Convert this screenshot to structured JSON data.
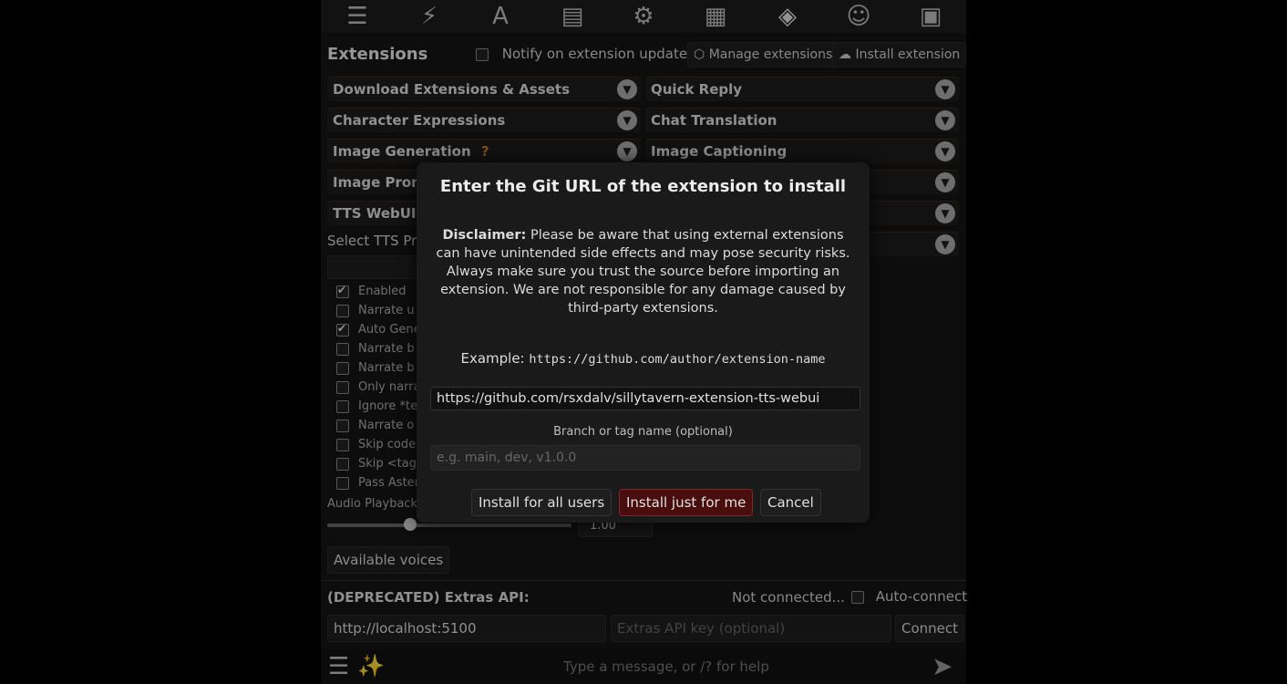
{
  "topbar": {
    "icons": [
      "sliders-icon",
      "plug-icon",
      "font-icon",
      "book-icon",
      "user-gear-icon",
      "image-icon",
      "cubes-icon",
      "smiley-icon",
      "id-card-icon"
    ]
  },
  "extensions": {
    "title": "Extensions",
    "notify_label": "Notify on extension updates",
    "manage_label": "Manage extensions",
    "install_label": "Install extension",
    "drawers_left": [
      "Download Extensions & Assets",
      "Character Expressions",
      "Image Generation",
      "Image Prom",
      "TTS WebUI A"
    ],
    "drawers_right": [
      "Quick Reply",
      "Chat Translation",
      "Image Captioning"
    ],
    "image_generation_help": "?"
  },
  "tts": {
    "select_label": "Select TTS Pro",
    "options": [
      {
        "label": "Enabled",
        "checked": true
      },
      {
        "label": "Narrate u",
        "checked": false
      },
      {
        "label": "Auto Gene",
        "checked": true
      },
      {
        "label": "Narrate b",
        "checked": false
      },
      {
        "label": "Narrate b",
        "checked": false
      },
      {
        "label": "Only narra",
        "checked": false
      },
      {
        "label": "Ignore *te",
        "checked": false
      },
      {
        "label": "Narrate o",
        "checked": false
      },
      {
        "label": "Skip code",
        "checked": false
      },
      {
        "label": "Skip <tag",
        "checked": false
      },
      {
        "label": "Pass Aster",
        "checked": false
      }
    ],
    "playback_label": "Audio Playback S",
    "playback_value": "1.00",
    "playback_fraction": 0.34,
    "voices_button": "Available voices"
  },
  "extras_api": {
    "title": "(DEPRECATED) Extras API:",
    "status": "Not connected...",
    "autoconnect_label": "Auto-connect",
    "url_value": "http://localhost:5100",
    "key_placeholder": "Extras API key (optional)",
    "connect_label": "Connect"
  },
  "chat": {
    "placeholder": "Type a message, or /? for help"
  },
  "modal": {
    "title": "Enter the Git URL of the extension to install",
    "disclaimer_bold": "Disclaimer:",
    "disclaimer_text": " Please be aware that using external extensions can have unintended side effects and may pose security risks. Always make sure you trust the source before importing an extension. We are not responsible for any damage caused by third-party extensions.",
    "example_label": "Example: ",
    "example_url": "https://github.com/author/extension-name",
    "url_value": "https://github.com/rsxdalv/sillytavern-extension-tts-webui",
    "branch_label": "Branch or tag name (optional)",
    "branch_placeholder": "e.g. main, dev, v1.0.0",
    "btn_all_users": "Install for all users",
    "btn_just_me": "Install just for me",
    "btn_cancel": "Cancel"
  }
}
